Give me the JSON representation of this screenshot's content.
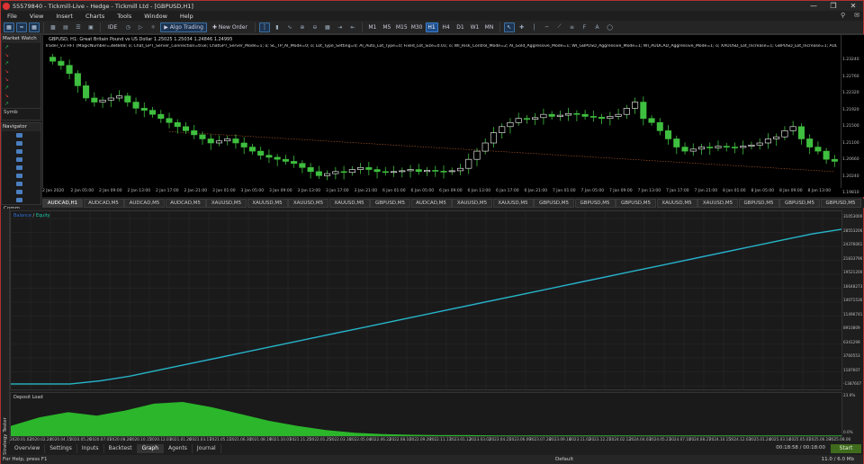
{
  "window": {
    "title": "55579840 - Tickmill-Live - Hedge - Tickmill Ltd - [GBPUSD,H1]",
    "controls": [
      "—",
      "❐",
      "✕"
    ]
  },
  "menu": {
    "items": [
      "File",
      "View",
      "Insert",
      "Charts",
      "Tools",
      "Window",
      "Help"
    ],
    "right_icons": [
      "search-icon",
      "chat-icon"
    ]
  },
  "toolbar": {
    "ide_label": "IDE",
    "algo_trading_label": "Algo Trading",
    "new_order_label": "New Order",
    "timeframes": [
      "M1",
      "M5",
      "M15",
      "M30",
      "H1",
      "H4",
      "D1",
      "W1",
      "MN"
    ],
    "active_timeframe": "H1",
    "accent": "#1e4e8c"
  },
  "market_watch": {
    "title": "Market Watch",
    "rows": [
      {
        "dir": "up"
      },
      {
        "dir": "dn"
      },
      {
        "dir": "up"
      },
      {
        "dir": "dn"
      },
      {
        "dir": "dn"
      },
      {
        "dir": "up"
      },
      {
        "dir": "dn"
      },
      {
        "dir": "up"
      }
    ],
    "footer": "Symb"
  },
  "navigator": {
    "title": "Navigator",
    "items": 9,
    "footer": "Comm"
  },
  "chart": {
    "header": "GBPUSD, H1: Great Britain Pound vs US Dollar  1.25025 1.25034 1.24846 1.24995",
    "params": "Trader_V3 HFT (MagicNumber=384848; o; Chat_GPT_Server_Connection=true; ChatGPT_Server_Mode=1; o; SL_TP_AI_Mode=0; o; Lot_Type_Setting=0; AI_Auto_Lot_Type=0; Fixed_Lot_Size=0.01; o; WI_Risk_Control_Mode=2; AI_Gold_Aggressive_Mode=1; WI_GBPUSD_Aggressive_Mode=1; WI_AUDCAD_Aggressive_Mode=1; o; XAUUSD_Lot_Increase=1; GBPUSD_Lot_Increase=1; AUDCAD_Lot_Increase=1",
    "price_labels": [
      "1.23240",
      "1.22760",
      "1.22320",
      "1.21920",
      "1.21500",
      "1.21100",
      "1.20660",
      "1.20240",
      "1.19810"
    ],
    "time_labels": [
      "2 Jan 2020",
      "2 Jan 05:00",
      "2 Jan 09:00",
      "2 Jan 13:00",
      "2 Jan 17:00",
      "2 Jan 21:00",
      "3 Jan 01:00",
      "3 Jan 05:00",
      "3 Jan 09:00",
      "3 Jan 13:00",
      "3 Jan 17:00",
      "3 Jan 21:00",
      "6 Jan 01:00",
      "6 Jan 05:00",
      "6 Jan 09:00",
      "6 Jan 13:00",
      "6 Jan 17:00",
      "6 Jan 21:00",
      "7 Jan 01:00",
      "7 Jan 05:00",
      "7 Jan 09:00",
      "7 Jan 13:00",
      "7 Jan 17:00",
      "7 Jan 21:00",
      "8 Jan 01:00",
      "8 Jan 05:00",
      "8 Jan 09:00",
      "8 Jan 13:00"
    ],
    "bull_color": "#ffffff",
    "bear_color": "#3fbf3f",
    "closes": [
      1.23,
      1.229,
      1.227,
      1.224,
      1.221,
      1.22,
      1.2205,
      1.221,
      1.2215,
      1.22,
      1.2185,
      1.218,
      1.217,
      1.216,
      1.215,
      1.214,
      1.213,
      1.212,
      1.211,
      1.21,
      1.2105,
      1.211,
      1.21,
      1.209,
      1.208,
      1.207,
      1.2065,
      1.206,
      1.2055,
      1.205,
      1.204,
      1.203,
      1.202,
      1.2025,
      1.203,
      1.2028,
      1.2035,
      1.204,
      1.2035,
      1.203,
      1.2028,
      1.203,
      1.2032,
      1.2035,
      1.203,
      1.2033,
      1.2031,
      1.203,
      1.2032,
      1.2038,
      1.206,
      1.208,
      1.21,
      1.2125,
      1.214,
      1.215,
      1.216,
      1.2158,
      1.2162,
      1.217,
      1.2165,
      1.2168,
      1.2172,
      1.217,
      1.2165,
      1.2163,
      1.216,
      1.2165,
      1.217,
      1.2185,
      1.22,
      1.216,
      1.215,
      1.213,
      1.211,
      1.209,
      1.208,
      1.2085,
      1.209,
      1.2088,
      1.2092,
      1.209,
      1.2089,
      1.2092,
      1.2095,
      1.21,
      1.211,
      1.2115,
      1.213,
      1.214,
      1.211,
      1.209,
      1.208,
      1.206,
      1.2055
    ]
  },
  "tabs": {
    "items": [
      "AUDCAD,H1",
      "AUDCAD,M5",
      "AUDCAD,M5",
      "AUDCAD,M5",
      "XAUUSD,M5",
      "XAUUSD,M5",
      "XAUUSD,M5",
      "XAUUSD,M5",
      "GBPUSD,M5",
      "AUDCAD,M5",
      "XAUUSD,M5",
      "XAUUSD,M5",
      "GBPUSD,M5",
      "GBPUSD,M5",
      "GBPUSD,M5",
      "XAUUSD,M5",
      "XAUUSD,M5",
      "GBPUSD,M5",
      "GBPUSD,M5",
      "GBPUSD,M5"
    ],
    "active_index": 0
  },
  "strategy_tester": {
    "side_label": "Strategy Tester",
    "balance_legend": "Balance",
    "equity_legend": "Equity",
    "balance_color": "#2f6fd6",
    "equity_color": "#1fc9a6",
    "balance_labels": [
      "31053000",
      "28553206",
      "24376061",
      "21833796",
      "19521200",
      "16648273",
      "14071536",
      "11496741",
      "8910809",
      "6341299",
      "3760553",
      "1187607",
      "-1387607"
    ],
    "deposit_legend": "Deposit Load",
    "deposit_color": "#2ec82e",
    "deposit_labels": [
      "23.9%",
      "0.0%"
    ],
    "date_labels": [
      "2020.01.02",
      "2020.02.24",
      "2020.04.15",
      "2020.05.26",
      "2020.07.01",
      "2020.08.28",
      "2020.10.15",
      "2020.12.03",
      "2021.01.26",
      "2021.03.17",
      "2021.05.11",
      "2021.06.30",
      "2021.08.19",
      "2021.10.07",
      "2021.11.25",
      "2022.01.25",
      "2022.03.16",
      "2022.05.04",
      "2022.06.22",
      "2022.08.10",
      "2022.09.29",
      "2022.11.17",
      "2023.01.12",
      "2023.03.02",
      "2023.04.21",
      "2023.06.09",
      "2023.07.28",
      "2023.09.18",
      "2023.11.02",
      "2023.12.21",
      "2024.02.12",
      "2024.04.03",
      "2024.05.21",
      "2024.07.10",
      "2024.08.27",
      "2024.10.15",
      "2024.12.03",
      "2025.01.24",
      "2025.03.14",
      "2025.05.01",
      "2025.06.19",
      "2025.08.06"
    ],
    "balance_curve": [
      0.0,
      0.0,
      0.0,
      0.02,
      0.05,
      0.09,
      0.13,
      0.17,
      0.21,
      0.25,
      0.29,
      0.33,
      0.37,
      0.41,
      0.45,
      0.49,
      0.53,
      0.57,
      0.61,
      0.65,
      0.69,
      0.73,
      0.77,
      0.81,
      0.85,
      0.89,
      0.93,
      0.97,
      1.0
    ],
    "deposit_load": [
      0.3,
      0.55,
      0.7,
      0.6,
      0.75,
      0.95,
      1.0,
      0.85,
      0.65,
      0.45,
      0.3,
      0.18,
      0.1,
      0.06,
      0.04,
      0.03,
      0.03,
      0.02,
      0.02,
      0.02,
      0.02,
      0.02,
      0.02,
      0.02,
      0.02,
      0.02,
      0.02,
      0.02,
      0.02,
      0.02
    ],
    "tabs": [
      "Overview",
      "Settings",
      "Inputs",
      "Backtest",
      "Graph",
      "Agents",
      "Journal"
    ],
    "active_tab": "Graph",
    "timer": "00:18:58 / 00:18:00",
    "start_label": "Start"
  },
  "status": {
    "help": "For Help, press F1",
    "profile": "Default",
    "traffic": "11.0 / 6.0 Mb"
  }
}
